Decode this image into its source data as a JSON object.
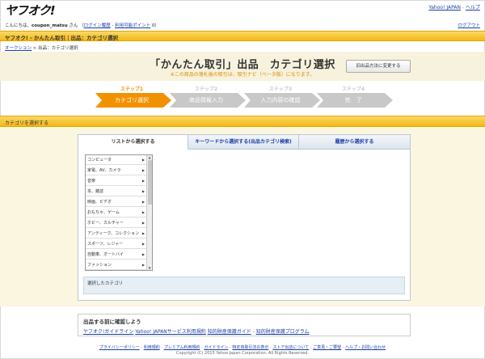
{
  "header": {
    "logo": "ヤフオク!",
    "links": [
      "Yahoo! JAPAN",
      "ヘルプ"
    ],
    "greeting_prefix": "こんにちは、",
    "username": "coupon_matsu",
    "greeting_suffix": "さん",
    "history_link": "ログイン履歴",
    "points_link": "利用可能ポイント",
    "points_suffix": "0",
    "logout": "ログアウト"
  },
  "orange_bar": {
    "title": "ヤフオク! - かんたん取引｜出品：カテゴリ選択"
  },
  "breadcrumb": {
    "home": "オークション",
    "current": "出品：カテゴリ選択"
  },
  "title_area": {
    "title": "「かんたん取引」出品　カテゴリ選択",
    "subtitle": "※この商品の落札後の取引は、取引ナビ（ベータ版）になります。",
    "old_method_button": "旧出品方法に変更する"
  },
  "steps": [
    {
      "num": "ステップ1",
      "label": "カテゴリ選択",
      "active": true
    },
    {
      "num": "ステップ2",
      "label": "商品情報入力",
      "active": false
    },
    {
      "num": "ステップ3",
      "label": "入力内容の確認",
      "active": false
    },
    {
      "num": "ステップ4",
      "label": "完　了",
      "active": false
    }
  ],
  "section": {
    "title": "カテゴリを選択する"
  },
  "tabs": [
    {
      "label": "リストから選択する",
      "active": true
    },
    {
      "label": "キーワードから選択する(出品カテゴリ検索)",
      "active": false
    },
    {
      "label": "履歴から選択する",
      "active": false
    }
  ],
  "categories": [
    "コンピュータ",
    "家電、AV、カメラ",
    "音楽",
    "本、雑誌",
    "映画、ビデオ",
    "おもちゃ、ゲーム",
    "ホビー、カルチャー",
    "アンティーク、コレクション",
    "スポーツ、レジャー",
    "自動車、オートバイ",
    "ファッション"
  ],
  "selected": {
    "label": "選択したカテゴリ"
  },
  "confirm": {
    "title": "出品する前に確認しよう",
    "links": [
      "ヤフオク!ガイドライン",
      "Yahoo! JAPANサービス利用規約",
      "知的財産保護ガイド",
      "知的財産保護プログラム"
    ]
  },
  "footer": {
    "links": [
      "プライバシーポリシー",
      "利用規約",
      "プレミアム利用規約",
      "ガイドライン",
      "特定商取引法の表示",
      "ストア出店について",
      "ご意見・ご要望",
      "ヘルプ・お問い合わせ"
    ],
    "copyright": "Copyright (C) 2015 Yahoo Japan Corporation. All Rights Reserved."
  },
  "colors": {
    "accent": "#f5b813",
    "step_active": "#f29100",
    "step_inactive": "#c8c8c8",
    "link": "#1a3fa6"
  }
}
